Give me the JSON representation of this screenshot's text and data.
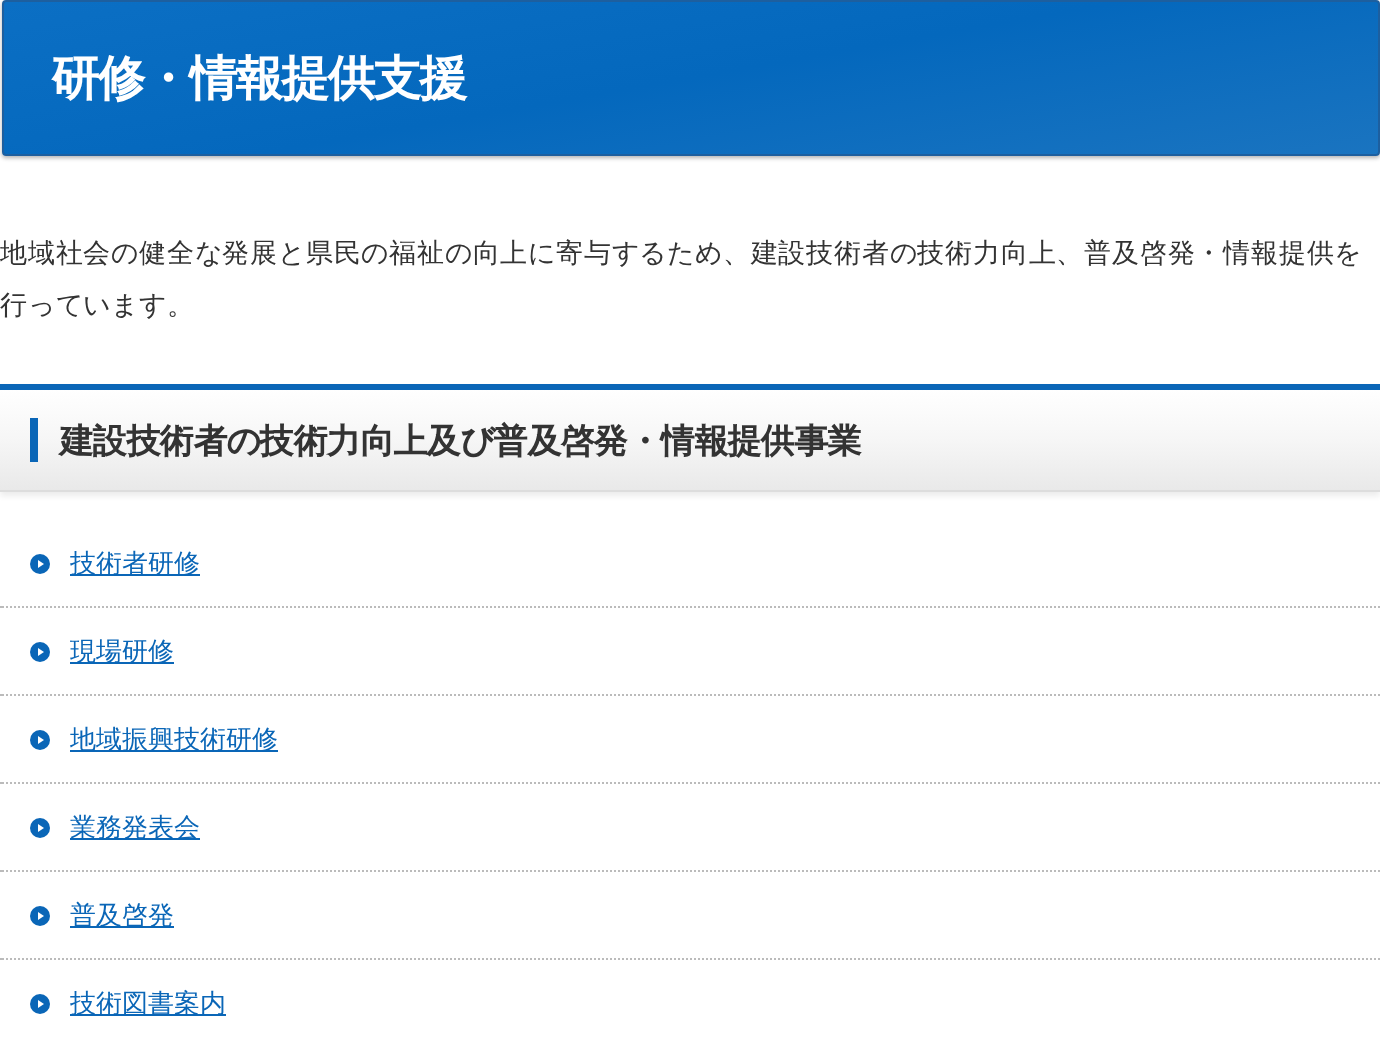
{
  "page_title": "研修・情報提供支援",
  "intro": "地域社会の健全な発展と県民の福祉の向上に寄与するため、建設技術者の技術力向上、普及啓発・情報提供を行っています。",
  "section": {
    "heading": "建設技術者の技術力向上及び普及啓発・情報提供事業",
    "links": [
      "技術者研修",
      "現場研修",
      "地域振興技術研修",
      "業務発表会",
      "普及啓発",
      "技術図書案内"
    ]
  }
}
